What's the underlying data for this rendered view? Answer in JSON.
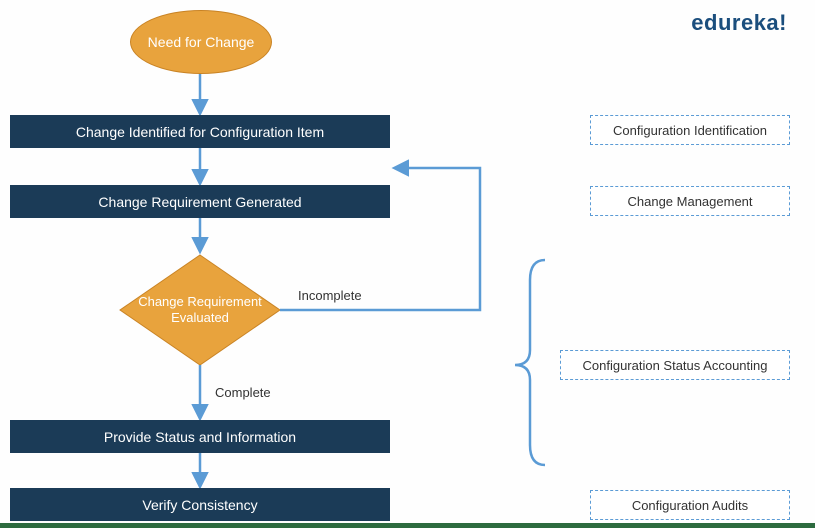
{
  "brand": "edureka!",
  "flow": {
    "start": "Need for Change",
    "step1": "Change Identified for Configuration Item",
    "step2": "Change Requirement Generated",
    "decision": "Change Requirement Evaluated",
    "edge_incomplete": "Incomplete",
    "edge_complete": "Complete",
    "step3": "Provide Status and Information",
    "step4": "Verify Consistency"
  },
  "side": {
    "s1": "Configuration Identification",
    "s2": "Change Management",
    "s3": "Configuration Status Accounting",
    "s4": "Configuration Audits"
  },
  "colors": {
    "accent_orange": "#e8a33d",
    "accent_dark": "#1b3b57",
    "line_blue": "#5b9bd5",
    "brand_color": "#1b4e7d"
  }
}
